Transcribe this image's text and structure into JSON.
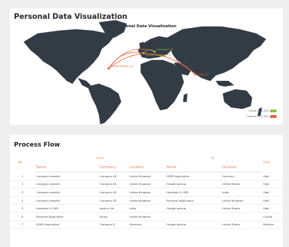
{
  "map_card": {
    "title": "Personal Data Visualization",
    "subtitle": "Personal Data Visualization",
    "map_labels": [
      "Germany (2)",
      "United Kingdom (4)",
      "United States (4)",
      "India (2)"
    ],
    "legend": [
      {
        "label": "Inside EU & EEA",
        "color": "#8dc044"
      },
      {
        "label": "Outside EU & EEA",
        "color": "#e8603c"
      }
    ]
  },
  "process_flow": {
    "title": "Process Flow",
    "group_headers": {
      "no": "No.",
      "from": "From",
      "to": "To",
      "risk": "Risk"
    },
    "sub_headers": {
      "from_name": "Name",
      "company": "Company",
      "location": "Location",
      "to_name": "Name",
      "to_location": "Location"
    },
    "rows": [
      {
        "no": "1",
        "from_name": "Company website",
        "company": "Company AS",
        "location": "United Kingdom",
        "to_name": "GDPR Application",
        "to_location": "Germany",
        "risk": "High",
        "risk_color": "#8dc044"
      },
      {
        "no": "2",
        "from_name": "Company website",
        "company": "Company AS",
        "location": "United Kingdom",
        "to_name": "Google backup",
        "to_location": "United States",
        "risk": "High",
        "risk_color": "#e8603c"
      },
      {
        "no": "3",
        "from_name": "Company website",
        "company": "Company AS",
        "location": "United Kingdom",
        "to_name": "Helpdesk & CRM",
        "to_location": "India",
        "risk": "High",
        "risk_color": "#e8603c"
      },
      {
        "no": "4",
        "from_name": "Company website",
        "company": "Company AS",
        "location": "United Kingdom",
        "to_name": "Payment Application",
        "to_location": "United Kingdom",
        "risk": "High",
        "risk_color": "#e8603c"
      },
      {
        "no": "5",
        "from_name": "Helpdesk & CRM",
        "company": "Jaiphur Ltd",
        "location": "India",
        "to_name": "Google backup",
        "to_location": "United States",
        "risk": "High",
        "risk_color": "#e8603c"
      },
      {
        "no": "6",
        "from_name": "Payment Application",
        "company": "Stripe",
        "location": "United Kingdom",
        "to_name": "",
        "to_location": "",
        "risk": "Critical",
        "risk_color": "#e8603c"
      },
      {
        "no": "7",
        "from_name": "GDPR Application",
        "company": "Company B",
        "location": "Germany",
        "to_name": "Google backup",
        "to_location": "United States",
        "risk": "Medium",
        "risk_color": "#e8603c"
      }
    ]
  }
}
